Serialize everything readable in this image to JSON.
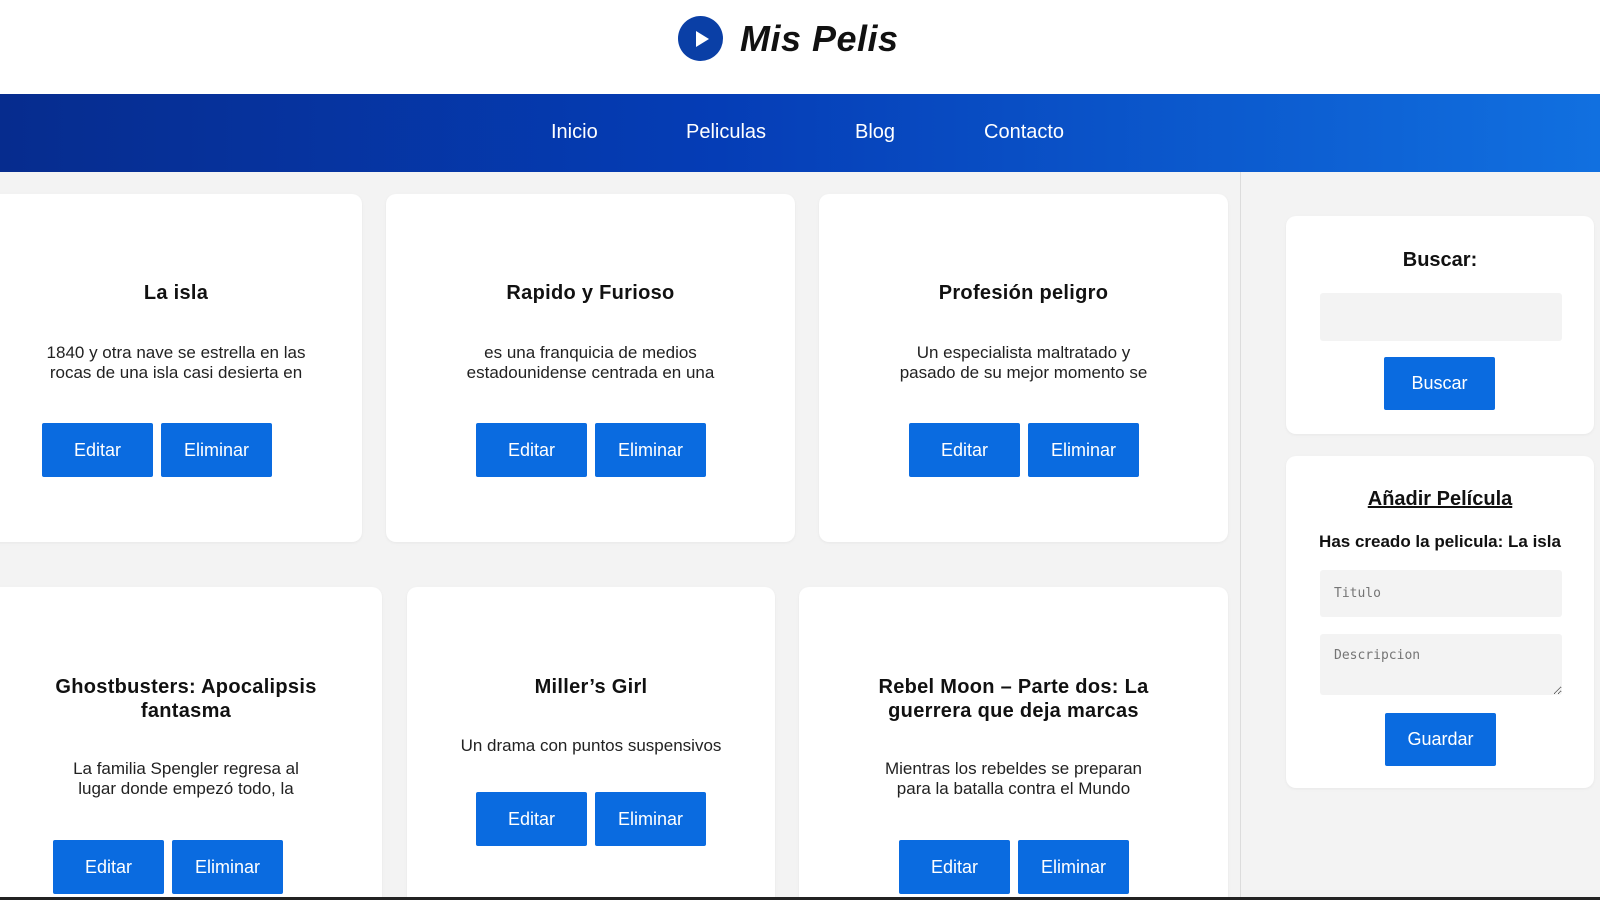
{
  "header": {
    "logo_title": "Mis Pelis"
  },
  "nav": {
    "items": [
      "Inicio",
      "Peliculas",
      "Blog",
      "Contacto"
    ]
  },
  "movies": [
    {
      "title": "La isla",
      "desc1": "1840 y otra nave se estrella en las",
      "desc2": "rocas de una isla casi desierta en",
      "edit": "Editar",
      "delete": "Eliminar"
    },
    {
      "title": "Rapido y Furioso",
      "desc1": "es una franquicia de medios",
      "desc2": "estadounidense centrada en una",
      "edit": "Editar",
      "delete": "Eliminar"
    },
    {
      "title": "Profesión peligro",
      "desc1": "Un especialista maltratado y",
      "desc2": "pasado de su mejor momento se",
      "edit": "Editar",
      "delete": "Eliminar"
    },
    {
      "title1": "Ghostbusters: Apocalipsis",
      "title2": "fantasma",
      "desc1": "La familia Spengler regresa al",
      "desc2": "lugar donde empezó todo, la",
      "edit": "Editar",
      "delete": "Eliminar"
    },
    {
      "title": "Miller’s Girl",
      "desc1": "Un drama con puntos suspensivos",
      "edit": "Editar",
      "delete": "Eliminar"
    },
    {
      "title1": "Rebel Moon – Parte dos: La",
      "title2": "guerrera que deja marcas",
      "desc1": "Mientras los rebeldes se preparan",
      "desc2": "para la batalla contra el Mundo",
      "edit": "Editar",
      "delete": "Eliminar"
    }
  ],
  "search": {
    "heading": "Buscar:",
    "value": "",
    "button": "Buscar"
  },
  "add": {
    "heading": "Añadir Película",
    "message": "Has creado la pelicula: La isla",
    "title_placeholder": "Titulo",
    "desc_placeholder": "Descripcion",
    "save": "Guardar"
  }
}
